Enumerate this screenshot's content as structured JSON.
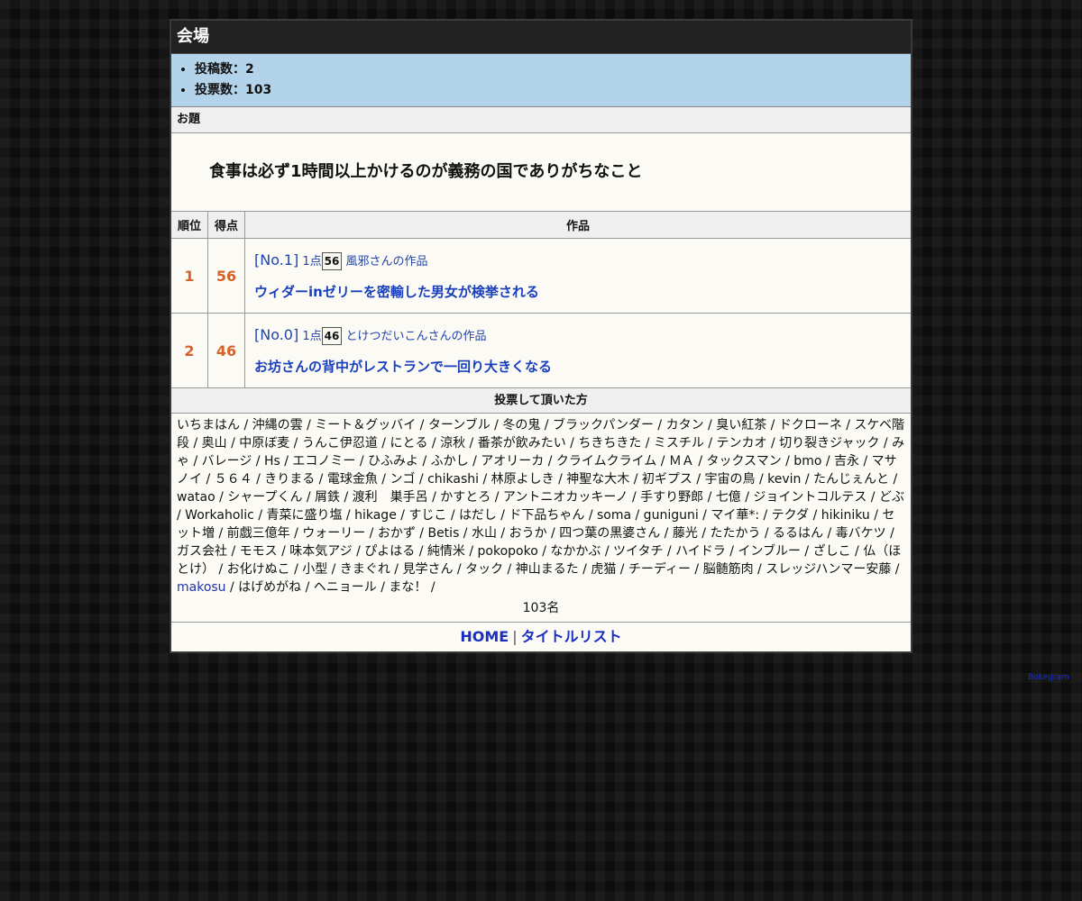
{
  "venue": {
    "title": "会場"
  },
  "stats": {
    "submissions": "投稿数：2",
    "votes": "投票数：103"
  },
  "prompt": {
    "heading": "お題",
    "text": "食事は必ず1時間以上かけるのが義務の国でありがちなこと"
  },
  "results": {
    "headers": {
      "rank": "順位",
      "score": "得点",
      "work": "作品"
    },
    "rows": [
      {
        "rank": "1",
        "score": "56",
        "entry_no": "[No.1]",
        "points_label": "1点",
        "points_box": "56",
        "author": "風邪さんの作品",
        "title": "ウィダーinゼリーを密輸した男女が検挙される"
      },
      {
        "rank": "2",
        "score": "46",
        "entry_no": "[No.0]",
        "points_label": "1点",
        "points_box": "46",
        "author": "とけつだいこんさんの作品",
        "title": "お坊さんの背中がレストランで一回り大きくなる"
      }
    ]
  },
  "voters": {
    "heading": "投票して頂いた方",
    "list_before_link": "いちまはん / 沖縄の雲 / ミート＆グッバイ / ターンブル / 冬の鬼 / ブラックパンダー / カタン / 臭い紅茶 / ドクローネ / スケベ階段 / 奥山 / 中原ぼ麦 / うんこ伊忍道 / にとる / 涼秋 / 番茶が飲みたい / ちきちきた / ミスチル / テンカオ / 切り裂きジャック / みゃ / バレージ / Hs / エコノミー / ひふみよ / ふかし / アオリーカ / クライムクライム / ＭＡ / タックスマン / bmo / 吉永 / マサノイ / ５６４ / きりまる / 電球金魚 / ンゴ / chikashi / 林原よしき / 神聖な大木 / 初ギプス / 宇宙の鳥 / kevin / たんじぇんと / watao / シャープくん / 屑鉄 / 渡利　巣手呂 / かすとろ / アントニオカッキーノ / 手すり野郎 / 七億 / ジョイントコルテス / どぶ / Workaholic / 青菜に盛り塩 / hikage / すじこ / はだし / ド下品ちゃん / soma / guniguni / マイ華*: / テクダ / hikiniku / セット増 / 前戯三億年 / ウォーリー / おかず / Betis / 水山 / おうか / 四つ葉の黒婆さん / 藤光 / たたかう / るるはん / 毒バケツ / ガス会社 / モモス / 味本気アジ / ぴよはる / 純情米 / pokopoko / なかかぶ / ツイタチ / ハイドラ / インブルー / ざしこ / 仏（ほとけ） / お化けぬこ / 小型 / きまぐれ / 見学さん / タック / 神山まるた / 虎猫 / チーディー / 脳髄筋肉 / スレッジハンマー安藤 / ",
    "link_name": "makosu",
    "list_after_link": " / はげめがね / ヘニョール / まな！ /",
    "count": "103名"
  },
  "footer": {
    "home": "HOME",
    "separator": "|",
    "title_list": "タイトルリスト"
  },
  "credit": "Bokegram",
  "colors": {
    "header_bg": "#222222",
    "stats_bg": "#b3d3ea",
    "score_orange": "#d4622a",
    "link_blue": "#1a3fbd"
  }
}
